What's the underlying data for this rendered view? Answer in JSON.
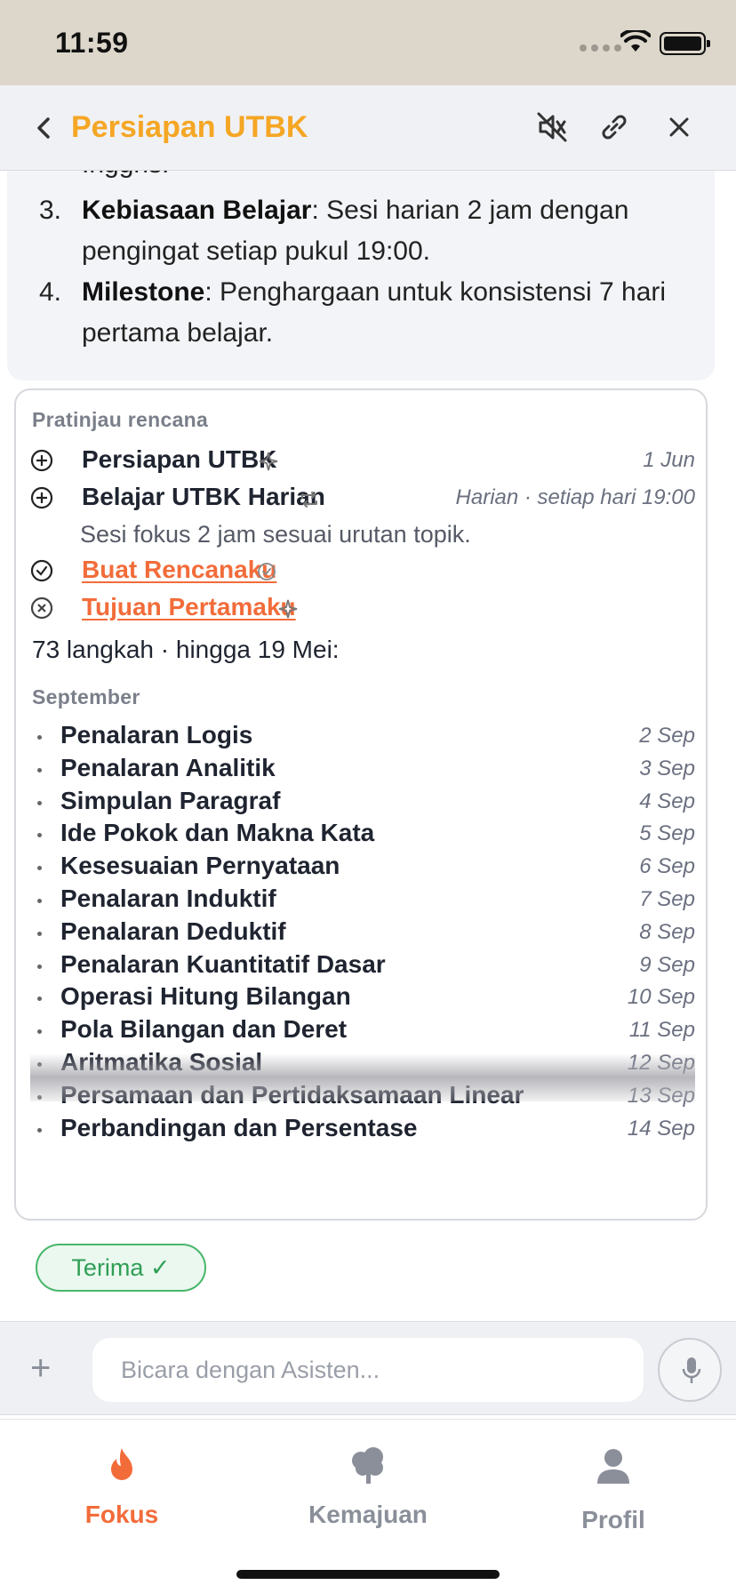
{
  "status": {
    "time": "11:59"
  },
  "nav": {
    "title": "Persiapan UTBK",
    "icons": [
      "back-chevron-icon",
      "mute-icon",
      "link-icon",
      "close-icon"
    ]
  },
  "message": {
    "clipped_text": "Inggris.",
    "items": [
      {
        "num": "3.",
        "bold": "Kebiasaan Belajar",
        "text": ": Sesi harian 2 jam dengan pengingat setiap pukul 19:00."
      },
      {
        "num": "4.",
        "bold": "Milestone",
        "text": ": Penghargaan untuk konsistensi 7 hari pertama belajar."
      }
    ]
  },
  "plan": {
    "heading": "Pratinjau rencana",
    "goal": {
      "title": "Persiapan UTBK",
      "date": "1 Jun"
    },
    "habit": {
      "title": "Belajar UTBK Harian",
      "schedule": "Harian · setiap hari 19:00",
      "description": "Sesi fokus 2 jam sesuai urutan topik."
    },
    "link1": "Buat Rencanaku",
    "link2": "Tujuan Pertamaku",
    "steps_summary": "73 langkah · hingga 19 Mei:",
    "month": "September",
    "tasks": [
      {
        "title": "Penalaran Logis",
        "date": "2 Sep"
      },
      {
        "title": "Penalaran Analitik",
        "date": "3 Sep"
      },
      {
        "title": "Simpulan Paragraf",
        "date": "4 Sep"
      },
      {
        "title": "Ide Pokok dan Makna Kata",
        "date": "5 Sep"
      },
      {
        "title": "Kesesuaian Pernyataan",
        "date": "6 Sep"
      },
      {
        "title": "Penalaran Induktif",
        "date": "7 Sep"
      },
      {
        "title": "Penalaran Deduktif",
        "date": "8 Sep"
      },
      {
        "title": "Penalaran Kuantitatif Dasar",
        "date": "9 Sep"
      },
      {
        "title": "Operasi Hitung Bilangan",
        "date": "10 Sep"
      },
      {
        "title": "Pola Bilangan dan Deret",
        "date": "11 Sep"
      },
      {
        "title": "Aritmatika Sosial",
        "date": "12 Sep"
      },
      {
        "title": "Persamaan dan Pertidaksamaan Linear",
        "date": "13 Sep"
      },
      {
        "title": "Perbandingan dan Persentase",
        "date": "14 Sep"
      }
    ]
  },
  "accept": {
    "label": "Terima ✓"
  },
  "composer": {
    "placeholder": "Bicara dengan Asisten..."
  },
  "tabs": [
    {
      "label": "Fokus",
      "icon": "flame-icon",
      "color": "#f26c3a"
    },
    {
      "label": "Kemajuan",
      "icon": "tree-icon",
      "color": "#8a8f99"
    },
    {
      "label": "Profil",
      "icon": "person-icon",
      "color": "#8a8f99"
    }
  ],
  "colors": {
    "accent": "#f5a623",
    "link": "#f26c3a",
    "success": "#48b66a"
  }
}
